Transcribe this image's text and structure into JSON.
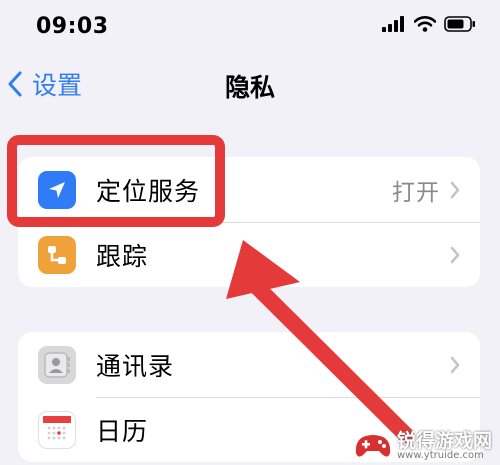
{
  "status_bar": {
    "time": "09:03",
    "icons": [
      "cellular-signal-icon",
      "wifi-icon",
      "battery-icon"
    ]
  },
  "nav": {
    "back_label": "设置",
    "title": "隐私"
  },
  "groups": [
    {
      "rows": [
        {
          "label": "定位服务",
          "value": "打开",
          "icon": "location-arrow-icon",
          "icon_color": "#2f7cf6",
          "highlighted": true
        },
        {
          "label": "跟踪",
          "value": "",
          "icon": "tracking-icon",
          "icon_color": "#f0a23a"
        }
      ]
    },
    {
      "rows": [
        {
          "label": "通讯录",
          "value": "",
          "icon": "contacts-icon",
          "icon_color": "#d8d8d8"
        },
        {
          "label": "日历",
          "value": "",
          "icon": "calendar-icon",
          "icon_color": "#ffffff"
        }
      ]
    }
  ],
  "annotation": {
    "highlight_color": "#e53a3a",
    "arrow_color": "#e53a3a"
  },
  "watermark": {
    "title": "锐得游戏网",
    "url": "www.ytruide.com"
  },
  "colors": {
    "background": "#f2f1f7",
    "accent": "#2f7cf6",
    "secondary_text": "#8a8a8e"
  }
}
